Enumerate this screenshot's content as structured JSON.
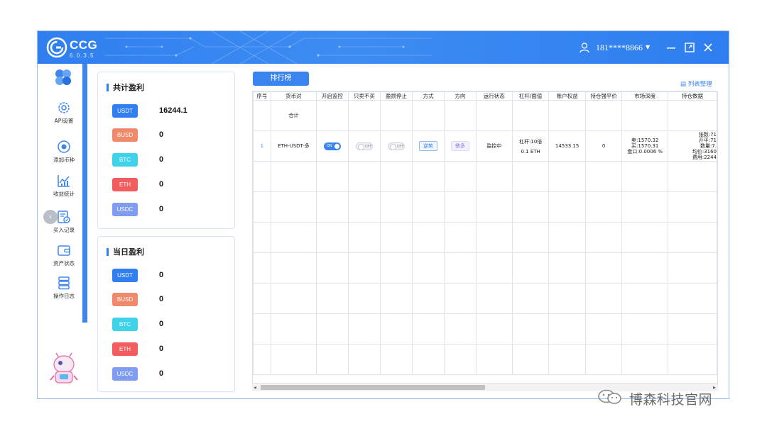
{
  "app": {
    "name": "CCG",
    "version": "6.0.3.5",
    "user_phone": "181****8866",
    "accent": "#2f7ff0"
  },
  "sidebar": {
    "items": [
      {
        "label": "API设置",
        "icon": "gear-icon"
      },
      {
        "label": "添加币种",
        "icon": "target-icon"
      },
      {
        "label": "收益统计",
        "icon": "chart-icon"
      },
      {
        "label": "买入记录",
        "icon": "record-icon"
      },
      {
        "label": "资产状态",
        "icon": "wallet-icon"
      },
      {
        "label": "操作日志",
        "icon": "log-icon"
      }
    ]
  },
  "total_profit": {
    "title": "共计盈利",
    "coins": [
      {
        "name": "USDT",
        "value": "16244.1",
        "color": "#2f7ff0"
      },
      {
        "name": "BUSD",
        "value": "0",
        "color": "#f08a6a"
      },
      {
        "name": "BTC",
        "value": "0",
        "color": "#3ed3ea"
      },
      {
        "name": "ETH",
        "value": "0",
        "color": "#f25c5c"
      },
      {
        "name": "USDC",
        "value": "0",
        "color": "#7f9cf0"
      }
    ]
  },
  "daily_profit": {
    "title": "当日盈利",
    "coins": [
      {
        "name": "USDT",
        "value": "0",
        "color": "#2f7ff0"
      },
      {
        "name": "BUSD",
        "value": "0",
        "color": "#f08a6a"
      },
      {
        "name": "BTC",
        "value": "0",
        "color": "#3ed3ea"
      },
      {
        "name": "ETH",
        "value": "0",
        "color": "#f25c5c"
      },
      {
        "name": "USDC",
        "value": "0",
        "color": "#7f9cf0"
      }
    ]
  },
  "toolbar": {
    "rank_label": "排行榜",
    "list_settings": "列表整理"
  },
  "table": {
    "headers": [
      "序号",
      "货币对",
      "开启监控",
      "只卖不买",
      "盈损停止",
      "方式",
      "方向",
      "运行状态",
      "杠杆/面值",
      "账户权益",
      "持仓强平价",
      "市场深度",
      "持仓数据"
    ],
    "total_label": "合计",
    "row": {
      "index": "1",
      "pair": "ETH-USDT-多",
      "monitor": "ON",
      "sell_only": "OFF",
      "stop": "OFF",
      "mode": "逆势",
      "direction": "做多",
      "status": "监控中",
      "leverage": "杠杆:10倍",
      "face_value": "0.1 ETH",
      "equity": "14533.15",
      "liq_price": "0",
      "depth_sell": "卖:1570.32",
      "depth_buy": "买:1570.31",
      "depth_spread": "盘口:0.0006 %",
      "pos_count": "张数:71",
      "pos_open": "开平:71",
      "pos_qty": "数量:7.",
      "pos_avg": "均价:3160",
      "pos_fee": "费用:2244"
    }
  },
  "watermark": "博森科技官网"
}
